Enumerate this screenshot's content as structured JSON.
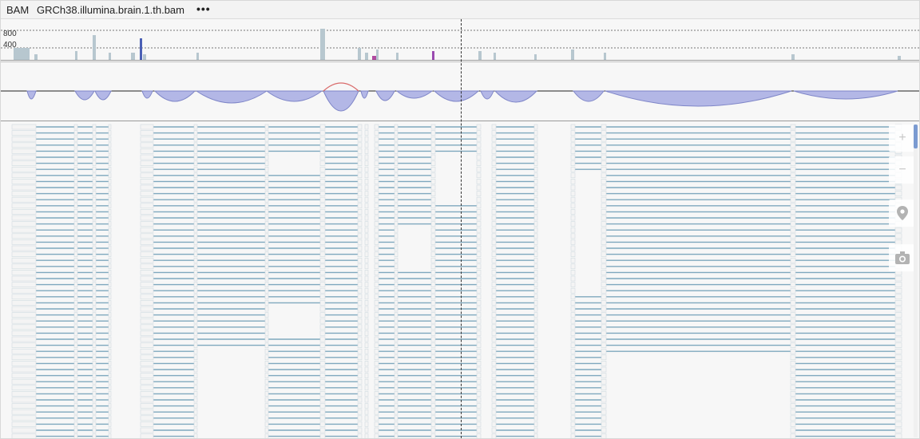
{
  "track": {
    "type_label": "BAM",
    "name": "GRCh38.illumina.brain.1.th.bam",
    "menu_label": "•••"
  },
  "coverage": {
    "scale_labels": [
      "800",
      "400"
    ]
  },
  "colors": {
    "coverage_fill": "#b7c7cf",
    "junction_fill": "#b3b7e6",
    "junction_stroke": "#7f86c8",
    "junction_highlight": "#d96b6b",
    "read_line": "#7fa8be",
    "read_fill": "#f4f4f4"
  },
  "toolbar": {
    "zoom_in_icon": "plus-icon",
    "zoom_out_icon": "minus-icon",
    "location_icon": "map-pin-icon",
    "snapshot_icon": "camera-icon"
  }
}
